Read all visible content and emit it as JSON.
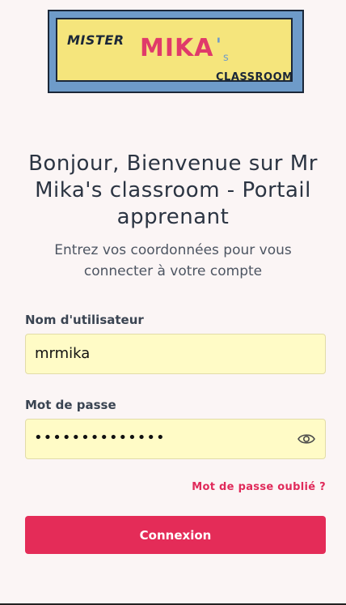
{
  "logo": {
    "word_mister": "MISTER",
    "word_mika": "MIKA",
    "apostrophe": "'",
    "suffix_s": "s",
    "word_classroom": "CLASSROOM"
  },
  "header": {
    "title": "Bonjour, Bienvenue sur Mr Mika's classroom - Portail apprenant",
    "subtitle": "Entrez vos coordonnées pour vous connecter à votre compte"
  },
  "form": {
    "username_label": "Nom d'utilisateur",
    "username_value": "mrmika",
    "password_label": "Mot de passe",
    "password_value": "••••••••••••••",
    "forgot_password": "Mot de passe oublié ?",
    "submit_label": "Connexion"
  },
  "icons": {
    "password_toggle": "eye-icon"
  },
  "colors": {
    "background": "#fbf5f5",
    "input_background": "#fffbc6",
    "accent": "#e42c58",
    "text": "#2b3442",
    "logo_frame": "#6e9bc9",
    "logo_panel": "#f5e57c"
  }
}
